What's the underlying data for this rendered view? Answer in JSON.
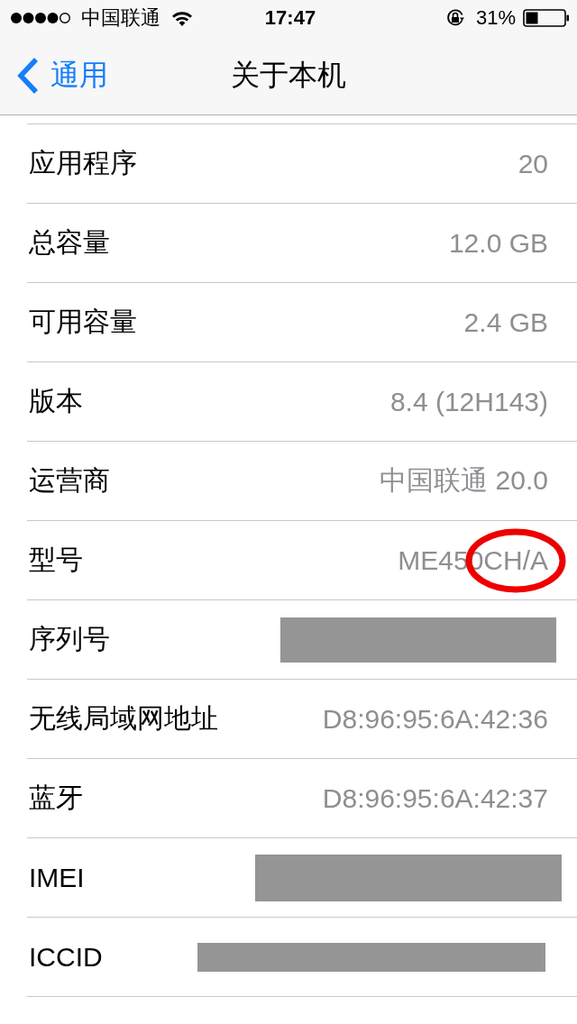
{
  "status_bar": {
    "carrier": "中国联通",
    "time": "17:47",
    "battery": "31%"
  },
  "nav_bar": {
    "back_label": "通用",
    "title": "关于本机"
  },
  "rows": [
    {
      "label": "应用程序",
      "kind": "text",
      "value": "20",
      "circled": false
    },
    {
      "label": "总容量",
      "kind": "text",
      "value": "12.0 GB",
      "circled": false
    },
    {
      "label": "可用容量",
      "kind": "text",
      "value": "2.4 GB",
      "circled": false
    },
    {
      "label": "版本",
      "kind": "text",
      "value": "8.4 (12H143)",
      "circled": false
    },
    {
      "label": "运营商",
      "kind": "text",
      "value": "中国联通 20.0",
      "circled": false
    },
    {
      "label": "型号",
      "kind": "text",
      "value": "ME450CH/A",
      "circled": true
    },
    {
      "label": "序列号",
      "kind": "redacted",
      "circled": false
    },
    {
      "label": "无线局域网地址",
      "kind": "text",
      "value": "D8:96:95:6A:42:36",
      "circled": false
    },
    {
      "label": "蓝牙",
      "kind": "text",
      "value": "D8:96:95:6A:42:37",
      "circled": false
    },
    {
      "label": "IMEI",
      "kind": "redacted",
      "circled": false
    },
    {
      "label": "ICCID",
      "kind": "redacted",
      "circled": false
    }
  ]
}
